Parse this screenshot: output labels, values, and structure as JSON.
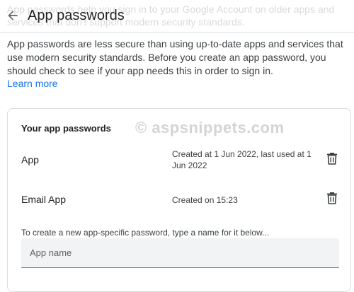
{
  "background_text": "App passwords help you sign in to your Google Account on older apps and services that don't support modern security standards.",
  "header": {
    "title": "App passwords",
    "back_icon": "arrow-left"
  },
  "intro": {
    "text": "App passwords are less secure than using up-to-date apps and services that use modern security standards. Before you create an app password, you should check to see if your app needs this in order to sign in.",
    "learn_more": "Learn more"
  },
  "card": {
    "title": "Your app passwords",
    "watermark": "© aspsnippets.com",
    "passwords": [
      {
        "name": "App",
        "meta": "Created at 1 Jun 2022, last used at 1 Jun 2022",
        "delete_icon": "trash-can"
      },
      {
        "name": "Email App",
        "meta": "Created on 15:23",
        "delete_icon": "trash-can"
      }
    ],
    "new_hint": "To create a new app-specific password, type a name for it below...",
    "input_placeholder": "App name",
    "input_value": ""
  },
  "colors": {
    "link": "#1a73e8",
    "divider": "#dadce0",
    "input_bg": "#f1f3f4"
  }
}
